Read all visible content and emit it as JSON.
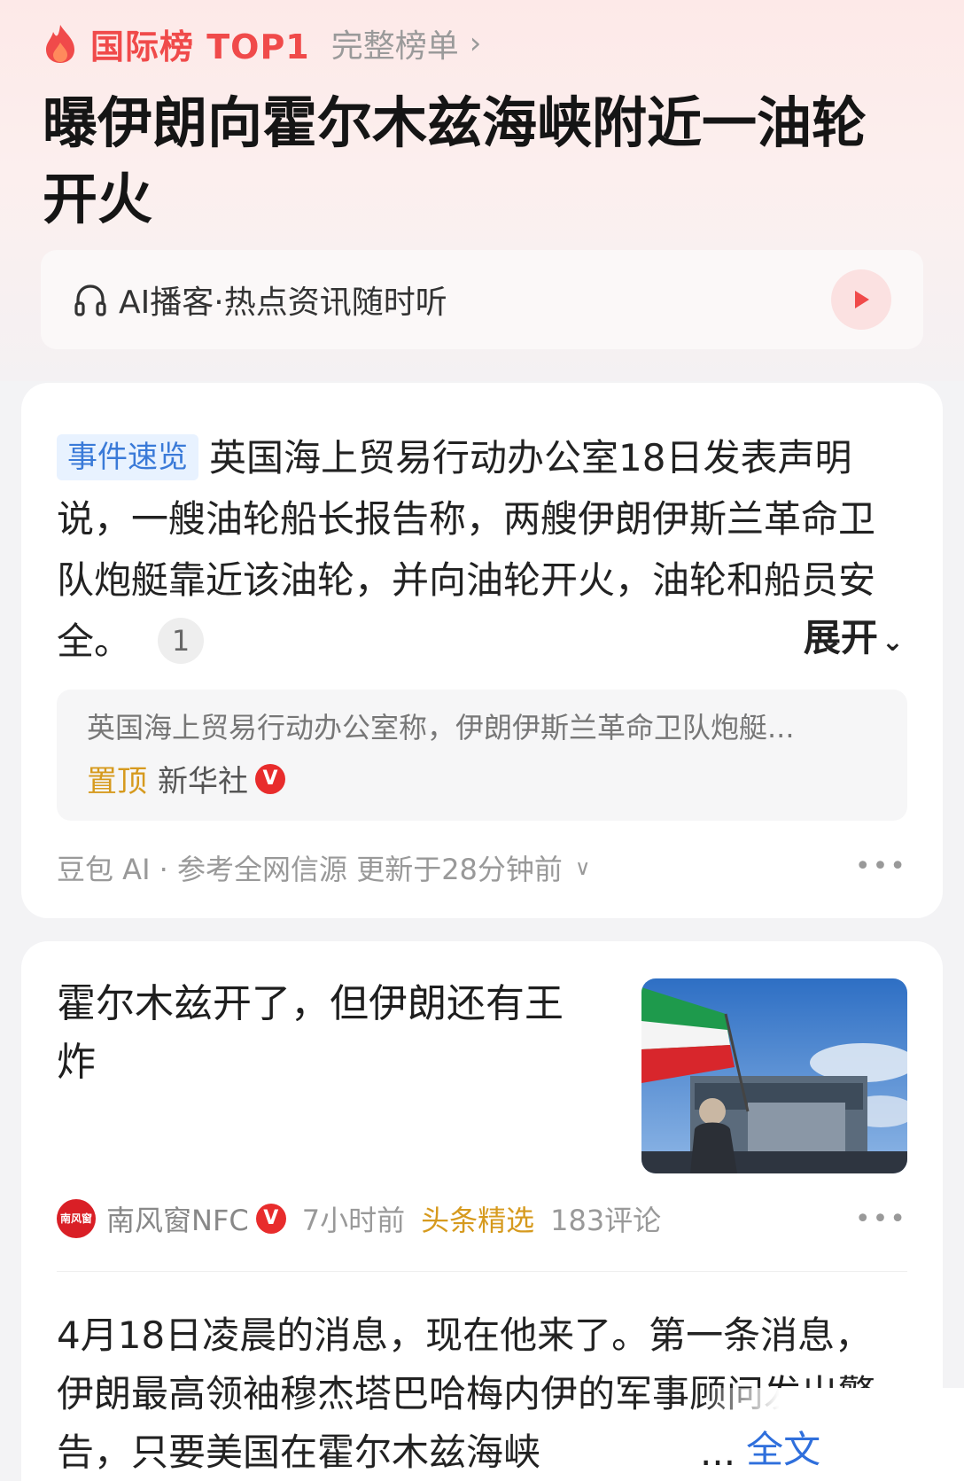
{
  "hot_rank": {
    "label": "国际榜 TOP1",
    "link": "完整榜单",
    "icon": "flame-icon"
  },
  "headline": "曝伊朗向霍尔木兹海峡附近一油轮开火",
  "podcast": {
    "label": "AI播客·热点资讯随时听",
    "icon": "headphones-icon",
    "play_icon": "play-icon"
  },
  "event_card": {
    "tag": "事件速览",
    "summary": "英国海上贸易行动办公室18日发表声明说，一艘油轮船长报告称，两艘伊朗伊斯兰革命卫队炮艇靠近该油轮，并向油轮开火，油轮和船员安全。",
    "ref_count": "1",
    "expand_label": "展开",
    "source": {
      "snippet": "英国海上贸易行动办公室称，伊朗伊斯兰革命卫队炮艇...",
      "pin_label": "置顶",
      "name": "新华社",
      "verified": "V"
    },
    "footer": "豆包 AI · 参考全网信源 更新于28分钟前"
  },
  "article": {
    "title": "霍尔木兹开了，但伊朗还有王炸",
    "publisher": "南风窗NFC",
    "publisher_logo": "南风窗",
    "verified": "V",
    "time": "7小时前",
    "feature_tag": "头条精选",
    "comments": "183评论",
    "body": "4月18日凌晨的消息，现在他来了。第一条消息，伊朗最高领袖穆杰塔巴哈梅内伊的军事顾问发出警告，只要美国在霍尔木兹海峡",
    "ellipsis": "...",
    "full_text_label": "全文"
  },
  "colors": {
    "accent_red": "#f04a4a",
    "tag_blue": "#3a7ad8",
    "gold": "#d69a1e",
    "link_blue": "#2f6fdc"
  }
}
